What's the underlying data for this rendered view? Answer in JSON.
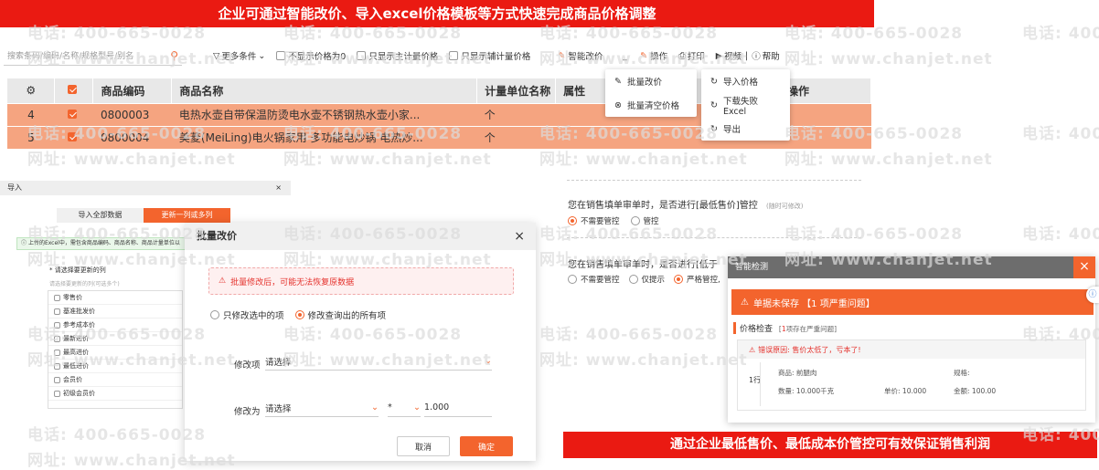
{
  "banners": {
    "top": "企业可通过智能改价、导入excel价格模板等方式快速完成商品价格调整",
    "bottom": "通过企业最低售价、最低成本价管控可有效保证销售利润"
  },
  "watermark": {
    "phone": "电话: 400-665-0028",
    "site": "网址: www.chanjet.net"
  },
  "toolbar": {
    "search_placeholder": "搜索条码/编码/名称/规格型号/别名",
    "more": "更多条件",
    "opt1": "不显示价格为0",
    "opt2": "只显示主计量价格",
    "opt3": "只显示辅计量价格",
    "smart_price": "智能改价",
    "operate": "操作",
    "print": "打印",
    "video": "视频",
    "help": "帮助"
  },
  "grid": {
    "headers": [
      "商品编码",
      "商品名称",
      "计量单位名称",
      "属性",
      "",
      "操作"
    ],
    "rows": [
      {
        "idx": "4",
        "code": "0800003",
        "name": "电热水壶自带保温防烫电水壶不锈钢热水壶小家...",
        "unit": "个"
      },
      {
        "idx": "5",
        "code": "0800004",
        "name": "美菱(MeiLing)电火锅家用 多功能电炒锅 电热炒...",
        "unit": "个"
      }
    ]
  },
  "menu_smart": [
    "批量改价",
    "批量清空价格"
  ],
  "menu_operate": [
    "导入价格",
    "下载失败Excel",
    "导出"
  ],
  "import_panel": {
    "title": "导入",
    "tab1": "导入全部数据",
    "tab2": "更新一列或多列",
    "tip": "上传的Excel中，需包含商品编码、商品名称、商品计量单位以",
    "req": "* 请选择要更新的列",
    "sub": "请选择要更新的列(可选多个)",
    "cols": [
      "零售价",
      "基准批发价",
      "参考成本价",
      "最新进价",
      "最高进价",
      "最低进价",
      "会员价",
      "初级会员价"
    ]
  },
  "modal": {
    "title": "批量改价",
    "warning": "批量修改后，可能无法恢复原数据",
    "radio1": "只修改选中的项",
    "radio2": "修改查询出的所有项",
    "label1": "修改项",
    "placeholder1": "请选择",
    "label2": "修改为",
    "placeholder2": "请选择",
    "op": "*",
    "value": "1.000",
    "cancel": "取消",
    "ok": "确定"
  },
  "control": {
    "q1": "您在销售填单审单时，是否进行[最低售价]管控",
    "q1_hint": "(随时可修改)",
    "q1_opt1": "不需要管控",
    "q1_opt2": "管控",
    "q2": "您在销售填单审单时，是否进行[低于",
    "q2_opt1": "不需要管控",
    "q2_opt2": "仅提示",
    "q2_opt3": "严格管控,"
  },
  "check": {
    "title": "智能检测",
    "status": "单据未保存 【1 项严重问题】",
    "section": "价格检查",
    "section_count": "1",
    "section_tail": "项存在严重问题",
    "reason": "错误原因: 售价太低了，亏本了!",
    "row_no": "1行",
    "product_label": "商品:",
    "product": "前腿肉",
    "spec_label": "规格:",
    "qty_label": "数量:",
    "qty": "10.000千克",
    "price_label": "单价:",
    "price": "10.000",
    "amount_label": "金额:",
    "amount": "100.00"
  }
}
